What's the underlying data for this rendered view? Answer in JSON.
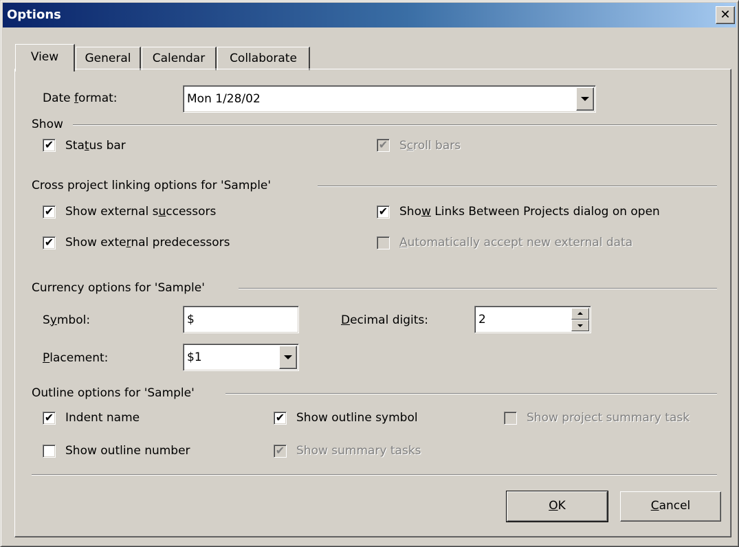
{
  "window": {
    "title": "Options",
    "close_glyph": "✕"
  },
  "tabs": [
    "View",
    "General",
    "Calendar",
    "Collaborate"
  ],
  "date_format": {
    "label_pre": "Date ",
    "label_mn": "f",
    "label_post": "ormat:",
    "value": "Mon 1/28/02"
  },
  "show": {
    "heading": "Show",
    "status_bar": {
      "pre": "Sta",
      "mn": "t",
      "post": "us bar",
      "checked": true,
      "enabled": true
    },
    "scroll_bars": {
      "pre": "S",
      "mn": "c",
      "post": "roll bars",
      "checked": true,
      "enabled": false
    }
  },
  "cross_project": {
    "heading": "Cross project linking options for 'Sample'",
    "external_successors": {
      "pre": "Show external s",
      "mn": "u",
      "post": "ccessors",
      "checked": true
    },
    "external_predecessors": {
      "pre": "Show exte",
      "mn": "r",
      "post": "nal predecessors",
      "checked": true
    },
    "links_dialog": {
      "pre": "Sho",
      "mn": "w",
      "post": " Links Between Projects dialog on open",
      "checked": true
    },
    "auto_accept": {
      "pre": "",
      "mn": "A",
      "post": "utomatically accept new external data",
      "checked": false,
      "enabled": false
    }
  },
  "currency": {
    "heading": "Currency options for 'Sample'",
    "symbol": {
      "pre": "S",
      "mn": "y",
      "post": "mbol:",
      "value": "$"
    },
    "decimal_digits": {
      "pre": "",
      "mn": "D",
      "post": "ecimal digits:",
      "value": "2"
    },
    "placement": {
      "pre": "",
      "mn": "P",
      "post": "lacement:",
      "value": "$1"
    }
  },
  "outline": {
    "heading": "Outline options for 'Sample'",
    "indent_name": {
      "label": "Indent name",
      "checked": true
    },
    "show_outline_symbol": {
      "label": "Show outline symbol",
      "checked": true
    },
    "show_project_summary": {
      "label": "Show project summary task",
      "checked": false,
      "enabled": false
    },
    "show_outline_number": {
      "label": "Show outline number",
      "checked": false
    },
    "show_summary_tasks": {
      "label": "Show summary tasks",
      "checked": true,
      "enabled": false
    }
  },
  "buttons": {
    "ok": {
      "pre": "",
      "mn": "O",
      "post": "K"
    },
    "cancel": {
      "pre": "",
      "mn": "C",
      "post": "ancel"
    }
  },
  "check_glyph": "✔"
}
